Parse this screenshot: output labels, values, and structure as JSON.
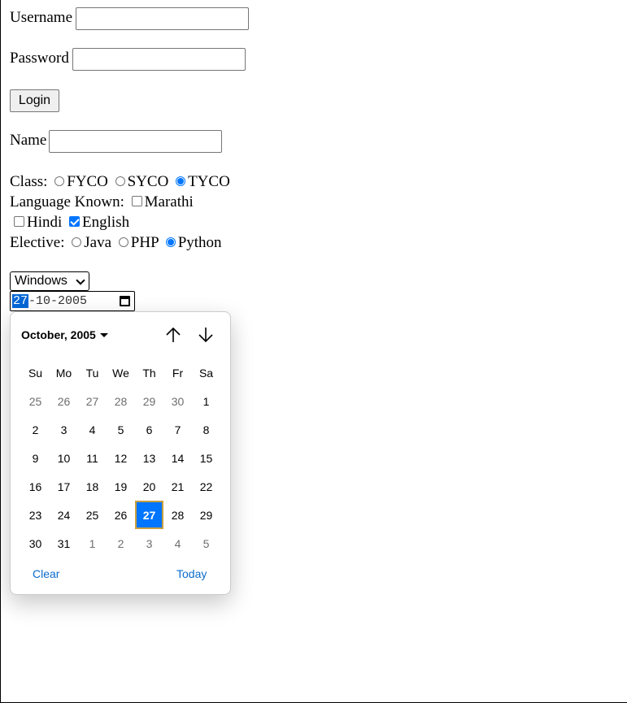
{
  "login": {
    "username_label": "Username",
    "password_label": "Password",
    "username_value": "",
    "password_value": "",
    "login_button": "Login"
  },
  "profile": {
    "name_label": "Name",
    "name_value": "",
    "class_label": "Class:",
    "class_options": [
      {
        "label": "FYCO",
        "selected": false
      },
      {
        "label": "SYCO",
        "selected": false
      },
      {
        "label": "TYCO",
        "selected": true
      }
    ],
    "language_label": "Language Known:",
    "languages": [
      {
        "label": "Marathi",
        "checked": false
      },
      {
        "label": "Hindi",
        "checked": false
      },
      {
        "label": "English",
        "checked": true
      }
    ],
    "elective_label": "Elective:",
    "electives": [
      {
        "label": "Java",
        "selected": false
      },
      {
        "label": "PHP",
        "selected": false
      },
      {
        "label": "Python",
        "selected": true
      }
    ],
    "os_select_value": "Windows",
    "date": {
      "day": "27",
      "rest": "-10-2005"
    }
  },
  "calendar": {
    "month_year": "October, 2005",
    "weekdays": [
      "Su",
      "Mo",
      "Tu",
      "We",
      "Th",
      "Fr",
      "Sa"
    ],
    "weeks": [
      [
        "25",
        "26",
        "27",
        "28",
        "29",
        "30",
        "1"
      ],
      [
        "2",
        "3",
        "4",
        "5",
        "6",
        "7",
        "8"
      ],
      [
        "9",
        "10",
        "11",
        "12",
        "13",
        "14",
        "15"
      ],
      [
        "16",
        "17",
        "18",
        "19",
        "20",
        "21",
        "22"
      ],
      [
        "23",
        "24",
        "25",
        "26",
        "27",
        "28",
        "29"
      ],
      [
        "30",
        "31",
        "1",
        "2",
        "3",
        "4",
        "5"
      ]
    ],
    "selected_day": "27",
    "clear_label": "Clear",
    "today_label": "Today",
    "accent_color": "#0075ff"
  }
}
